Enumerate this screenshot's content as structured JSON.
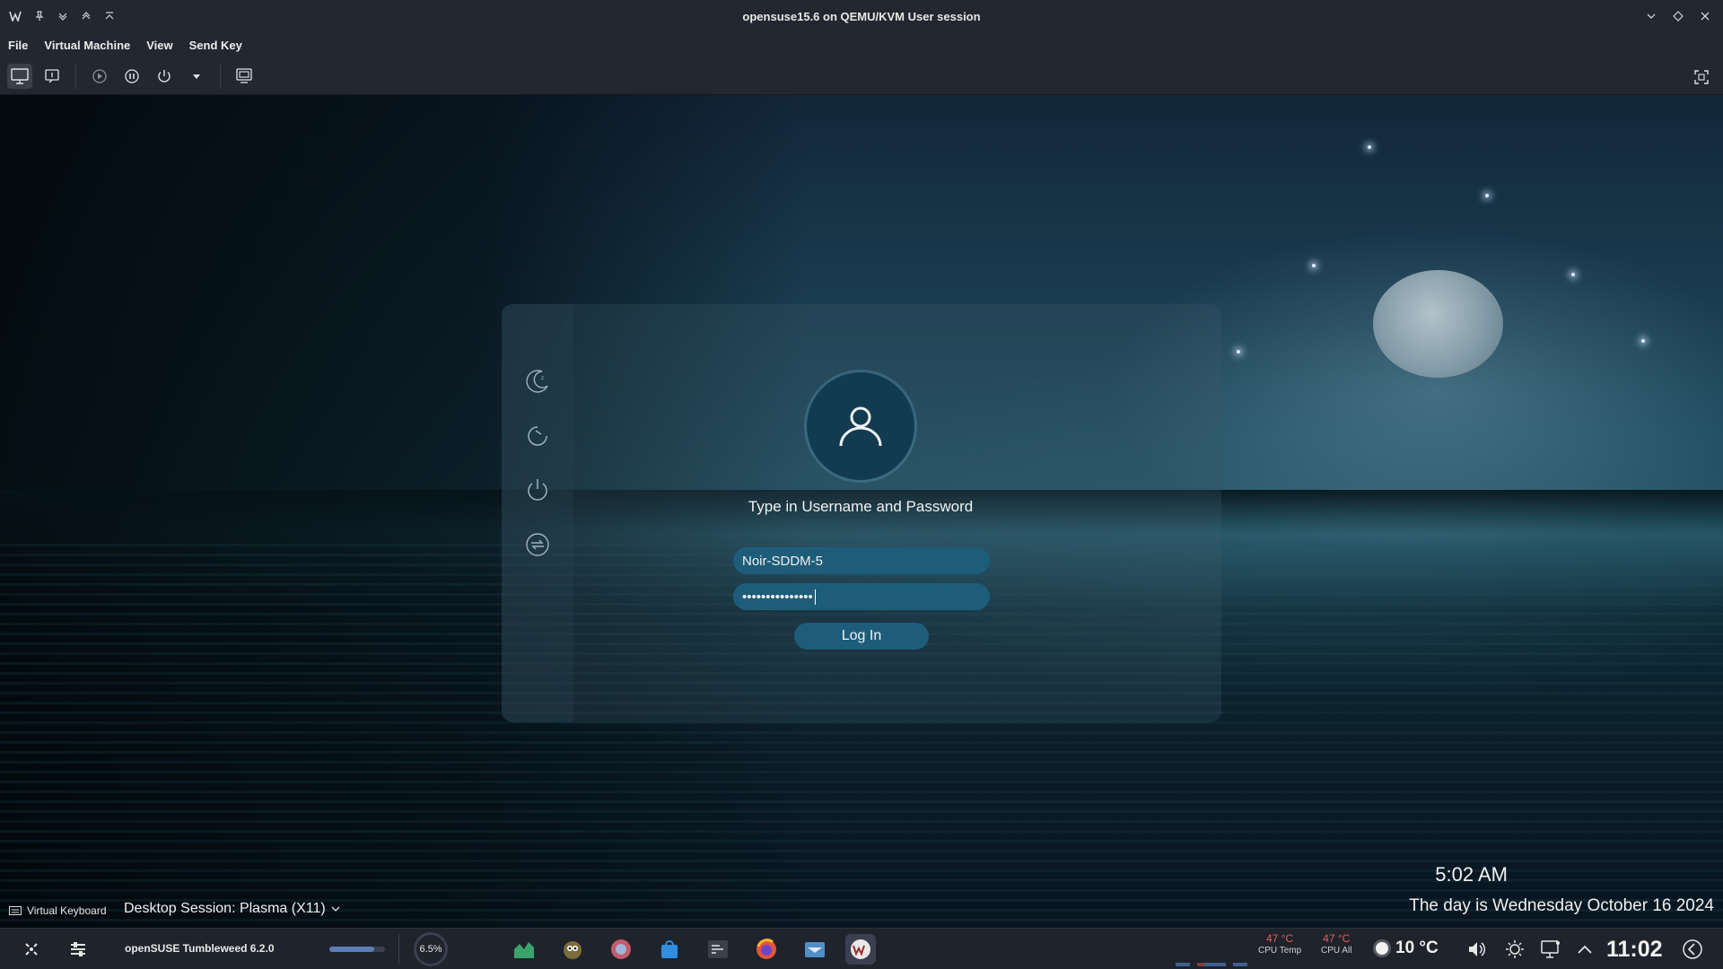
{
  "window": {
    "title": "opensuse15.6 on QEMU/KVM User session"
  },
  "menu": [
    "File",
    "Virtual Machine",
    "View",
    "Send Key"
  ],
  "login": {
    "prompt": "Type in Username and Password",
    "username": "Noir-SDDM-5",
    "password_mask": "•••••••••••••••",
    "login_label": "Log In"
  },
  "screen_footer": {
    "virtual_keyboard": "Virtual Keyboard",
    "session": "Desktop Session: Plasma (X11)",
    "time": "5:02 AM",
    "date": "The day is Wednesday October 16 2024"
  },
  "taskbar": {
    "distro": "openSUSE Tumbleweed 6.2.0",
    "progress_fraction": 0.8,
    "cpu_usage": "6.5%",
    "sensors": [
      {
        "value": "47 °C",
        "label": "CPU Temp"
      },
      {
        "value": "47 °C",
        "label": "CPU All"
      }
    ],
    "weather": "10 °C",
    "clock": "11:02"
  },
  "colors": {
    "accent": "#1d5d7a",
    "panel": "#232730",
    "taskbar": "#1f232b"
  }
}
